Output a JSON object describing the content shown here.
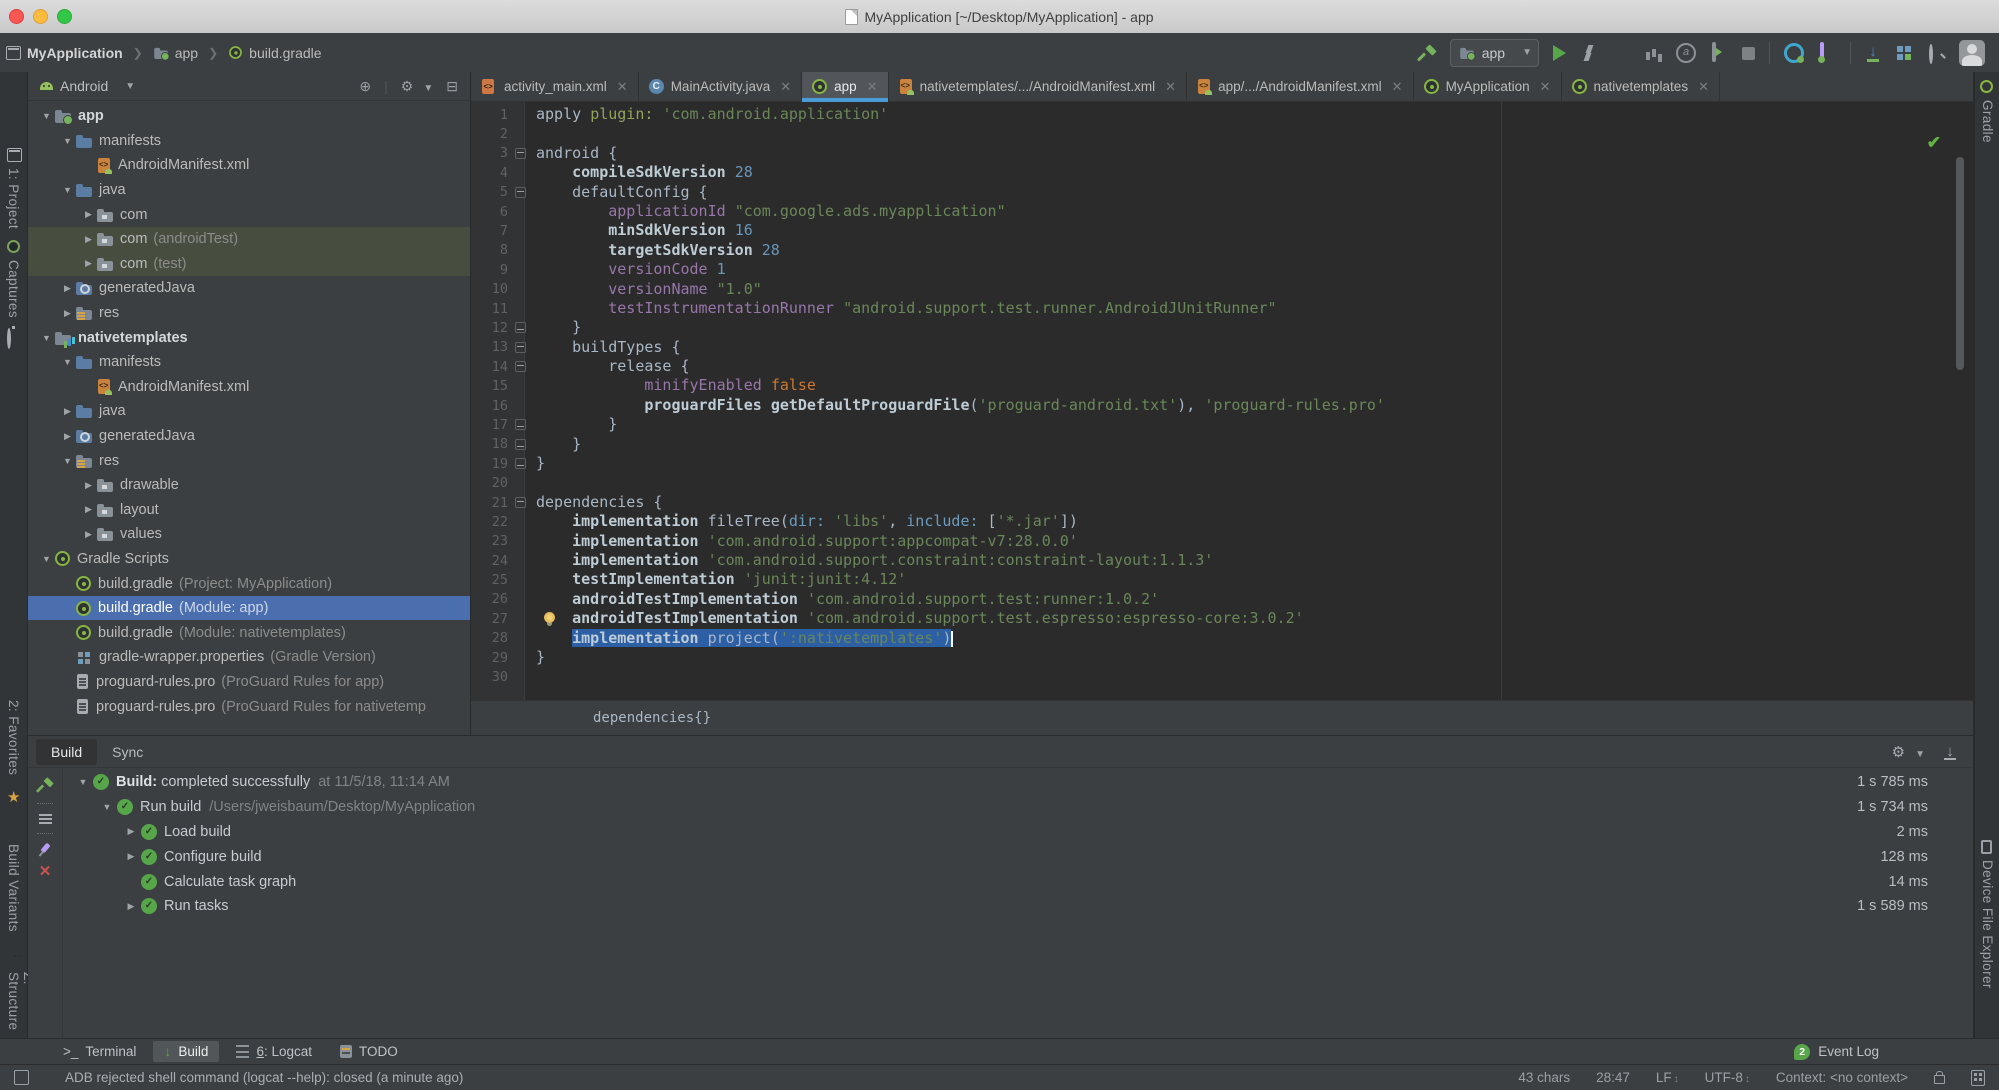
{
  "window": {
    "title": "MyApplication [~/Desktop/MyApplication] - app"
  },
  "toolbar": {
    "breadcrumbs": [
      "MyApplication",
      "app",
      "build.gradle"
    ],
    "run_config": "app"
  },
  "left_stripe": {
    "project": "1: Project",
    "captures": "Captures",
    "favorites": "2: Favorites",
    "build_variants": "Build Variants",
    "structure": "Z: Structure"
  },
  "right_stripe": {
    "gradle": "Gradle",
    "device_file_explorer": "Device File Explorer"
  },
  "project_panel": {
    "view": "Android",
    "tree": [
      {
        "ind": 0,
        "arrow": "down",
        "icon": "folder-app",
        "label": "app",
        "bold": true
      },
      {
        "ind": 1,
        "arrow": "down",
        "icon": "folder",
        "label": "manifests"
      },
      {
        "ind": 2,
        "arrow": "none",
        "icon": "manifest",
        "label": "AndroidManifest.xml"
      },
      {
        "ind": 1,
        "arrow": "down",
        "icon": "folder",
        "label": "java"
      },
      {
        "ind": 2,
        "arrow": "right",
        "icon": "package",
        "label": "com"
      },
      {
        "ind": 2,
        "arrow": "right",
        "icon": "package",
        "label": "com",
        "detail": "(androidTest)",
        "hl": true
      },
      {
        "ind": 2,
        "arrow": "right",
        "icon": "package",
        "label": "com",
        "detail": "(test)",
        "hl": true
      },
      {
        "ind": 1,
        "arrow": "right",
        "icon": "folder-gen",
        "label": "generatedJava"
      },
      {
        "ind": 1,
        "arrow": "right",
        "icon": "folder-res",
        "label": "res"
      },
      {
        "ind": 0,
        "arrow": "down",
        "icon": "module",
        "label": "nativetemplates",
        "bold": true
      },
      {
        "ind": 1,
        "arrow": "down",
        "icon": "folder",
        "label": "manifests"
      },
      {
        "ind": 2,
        "arrow": "none",
        "icon": "manifest",
        "label": "AndroidManifest.xml"
      },
      {
        "ind": 1,
        "arrow": "right",
        "icon": "folder",
        "label": "java"
      },
      {
        "ind": 1,
        "arrow": "right",
        "icon": "folder-gen",
        "label": "generatedJava"
      },
      {
        "ind": 1,
        "arrow": "down",
        "icon": "folder-res",
        "label": "res"
      },
      {
        "ind": 2,
        "arrow": "right",
        "icon": "package",
        "label": "drawable"
      },
      {
        "ind": 2,
        "arrow": "right",
        "icon": "package",
        "label": "layout"
      },
      {
        "ind": 2,
        "arrow": "right",
        "icon": "package",
        "label": "values"
      },
      {
        "ind": 0,
        "arrow": "down",
        "icon": "gradle",
        "label": "Gradle Scripts"
      },
      {
        "ind": 1,
        "arrow": "none",
        "icon": "gradle",
        "label": "build.gradle",
        "detail": "(Project: MyApplication)"
      },
      {
        "ind": 1,
        "arrow": "none",
        "icon": "gradle",
        "label": "build.gradle",
        "detail": "(Module: app)",
        "sel": true
      },
      {
        "ind": 1,
        "arrow": "none",
        "icon": "gradle",
        "label": "build.gradle",
        "detail": "(Module: nativetemplates)"
      },
      {
        "ind": 1,
        "arrow": "none",
        "icon": "wrapper",
        "label": "gradle-wrapper.properties",
        "detail": "(Gradle Version)"
      },
      {
        "ind": 1,
        "arrow": "none",
        "icon": "proguard",
        "label": "proguard-rules.pro",
        "detail": "(ProGuard Rules for app)"
      },
      {
        "ind": 1,
        "arrow": "none",
        "icon": "proguard",
        "label": "proguard-rules.pro",
        "detail": "(ProGuard Rules for nativetemp"
      }
    ]
  },
  "editor": {
    "tabs": [
      {
        "label": "activity_main.xml",
        "icon": "xml"
      },
      {
        "label": "MainActivity.java",
        "icon": "java"
      },
      {
        "label": "app",
        "icon": "gradle",
        "active": true
      },
      {
        "label": "nativetemplates/.../AndroidManifest.xml",
        "icon": "manifest"
      },
      {
        "label": "app/.../AndroidManifest.xml",
        "icon": "manifest"
      },
      {
        "label": "MyApplication",
        "icon": "gradle"
      },
      {
        "label": "nativetemplates",
        "icon": "gradle"
      }
    ],
    "context_bar": "dependencies{}",
    "lines": [
      {
        "n": 1,
        "t": [
          [
            "apply ",
            "p"
          ],
          [
            "plugin:",
            "g"
          ],
          [
            " ",
            "p"
          ],
          [
            "'com.android.application'",
            "s"
          ]
        ]
      },
      {
        "n": 2,
        "t": []
      },
      {
        "n": 3,
        "fold": "s",
        "t": [
          [
            "android {",
            "p"
          ]
        ]
      },
      {
        "n": 4,
        "t": [
          [
            "    ",
            "p"
          ],
          [
            "compileSdkVersion",
            "b"
          ],
          [
            " ",
            "p"
          ],
          [
            "28",
            "n"
          ]
        ]
      },
      {
        "n": 5,
        "fold": "s",
        "t": [
          [
            "    defaultConfig {",
            "p"
          ]
        ]
      },
      {
        "n": 6,
        "t": [
          [
            "        ",
            "p"
          ],
          [
            "applicationId",
            "k"
          ],
          [
            " ",
            "p"
          ],
          [
            "\"com.google.ads.myapplication\"",
            "s"
          ]
        ]
      },
      {
        "n": 7,
        "t": [
          [
            "        ",
            "p"
          ],
          [
            "minSdkVersion",
            "b"
          ],
          [
            " ",
            "p"
          ],
          [
            "16",
            "n"
          ]
        ]
      },
      {
        "n": 8,
        "t": [
          [
            "        ",
            "p"
          ],
          [
            "targetSdkVersion",
            "b"
          ],
          [
            " ",
            "p"
          ],
          [
            "28",
            "n"
          ]
        ]
      },
      {
        "n": 9,
        "t": [
          [
            "        ",
            "p"
          ],
          [
            "versionCode",
            "k"
          ],
          [
            " ",
            "p"
          ],
          [
            "1",
            "n"
          ]
        ]
      },
      {
        "n": 10,
        "t": [
          [
            "        ",
            "p"
          ],
          [
            "versionName",
            "k"
          ],
          [
            " ",
            "p"
          ],
          [
            "\"1.0\"",
            "s"
          ]
        ]
      },
      {
        "n": 11,
        "t": [
          [
            "        ",
            "p"
          ],
          [
            "testInstrumentationRunner",
            "k"
          ],
          [
            " ",
            "p"
          ],
          [
            "\"android.support.test.runner.AndroidJUnitRunner\"",
            "s"
          ]
        ]
      },
      {
        "n": 12,
        "fold": "e",
        "t": [
          [
            "    }",
            "p"
          ]
        ]
      },
      {
        "n": 13,
        "fold": "s",
        "t": [
          [
            "    buildTypes {",
            "p"
          ]
        ]
      },
      {
        "n": 14,
        "fold": "s",
        "t": [
          [
            "        release {",
            "p"
          ]
        ]
      },
      {
        "n": 15,
        "t": [
          [
            "            ",
            "p"
          ],
          [
            "minifyEnabled",
            "k"
          ],
          [
            " ",
            "p"
          ],
          [
            "false",
            "o"
          ]
        ]
      },
      {
        "n": 16,
        "t": [
          [
            "            ",
            "p"
          ],
          [
            "proguardFiles",
            "b"
          ],
          [
            " ",
            "p"
          ],
          [
            "getDefaultProguardFile",
            "b"
          ],
          [
            "(",
            "p"
          ],
          [
            "'proguard-android.txt'",
            "s"
          ],
          [
            "), ",
            "p"
          ],
          [
            "'proguard-rules.pro'",
            "s"
          ]
        ]
      },
      {
        "n": 17,
        "fold": "e",
        "t": [
          [
            "        }",
            "p"
          ]
        ]
      },
      {
        "n": 18,
        "fold": "e",
        "t": [
          [
            "    }",
            "p"
          ]
        ]
      },
      {
        "n": 19,
        "fold": "e",
        "t": [
          [
            "}",
            "p"
          ]
        ]
      },
      {
        "n": 20,
        "t": []
      },
      {
        "n": 21,
        "fold": "s",
        "t": [
          [
            "dependencies {",
            "p"
          ]
        ]
      },
      {
        "n": 22,
        "t": [
          [
            "    ",
            "p"
          ],
          [
            "implementation",
            "b"
          ],
          [
            " fileTree(",
            "p"
          ],
          [
            "dir:",
            "a"
          ],
          [
            " ",
            "p"
          ],
          [
            "'libs'",
            "s"
          ],
          [
            ", ",
            "p"
          ],
          [
            "include:",
            "a"
          ],
          [
            " [",
            "p"
          ],
          [
            "'*.jar'",
            "s"
          ],
          [
            "])",
            "p"
          ]
        ]
      },
      {
        "n": 23,
        "t": [
          [
            "    ",
            "p"
          ],
          [
            "implementation",
            "b"
          ],
          [
            " ",
            "p"
          ],
          [
            "'com.android.support:appcompat-v7:28.0.0'",
            "s"
          ]
        ]
      },
      {
        "n": 24,
        "t": [
          [
            "    ",
            "p"
          ],
          [
            "implementation",
            "b"
          ],
          [
            " ",
            "p"
          ],
          [
            "'com.android.support.constraint:constraint-layout:1.1.3'",
            "s"
          ]
        ]
      },
      {
        "n": 25,
        "t": [
          [
            "    ",
            "p"
          ],
          [
            "testImplementation",
            "b"
          ],
          [
            " ",
            "p"
          ],
          [
            "'junit:junit:4.12'",
            "s"
          ]
        ]
      },
      {
        "n": 26,
        "t": [
          [
            "    ",
            "p"
          ],
          [
            "androidTestImplementation",
            "b"
          ],
          [
            " ",
            "p"
          ],
          [
            "'com.android.support.test:runner:1.0.2'",
            "s"
          ]
        ]
      },
      {
        "n": 27,
        "bulb": true,
        "t": [
          [
            "    ",
            "p"
          ],
          [
            "androidTestImplementation",
            "b"
          ],
          [
            " ",
            "p"
          ],
          [
            "'com.android.support.test.espresso:espresso-core:3.0.2'",
            "s"
          ]
        ]
      },
      {
        "n": 28,
        "sel": true,
        "caret": true,
        "t": [
          [
            "    ",
            "p"
          ],
          [
            "implementation",
            "b"
          ],
          [
            " ",
            "p"
          ],
          [
            "project",
            "p"
          ],
          [
            "(",
            "p"
          ],
          [
            "':nativetemplates'",
            "s"
          ],
          [
            ")",
            "p"
          ]
        ]
      },
      {
        "n": 29,
        "t": [
          [
            "}",
            "p"
          ]
        ]
      },
      {
        "n": 30,
        "t": []
      }
    ]
  },
  "build_panel": {
    "tabs": [
      {
        "label": "Build",
        "active": true
      },
      {
        "label": "Sync"
      }
    ],
    "rows": [
      {
        "ind": 0,
        "arrow": "down",
        "label": "Build:",
        "bold": true,
        "label2": "completed successfully",
        "detail": "at 11/5/18, 11:14 AM",
        "time": "1 s 785 ms"
      },
      {
        "ind": 1,
        "arrow": "down",
        "label": "Run build",
        "label2": "",
        "detail": "/Users/jweisbaum/Desktop/MyApplication",
        "time": "1 s 734 ms"
      },
      {
        "ind": 2,
        "arrow": "right",
        "label": "Load build",
        "label2": "",
        "detail": "",
        "time": "2 ms"
      },
      {
        "ind": 2,
        "arrow": "right",
        "label": "Configure build",
        "label2": "",
        "detail": "",
        "time": "128 ms"
      },
      {
        "ind": 2,
        "arrow": "none",
        "label": "Calculate task graph",
        "label2": "",
        "detail": "",
        "time": "14 ms"
      },
      {
        "ind": 2,
        "arrow": "right",
        "label": "Run tasks",
        "label2": "",
        "detail": "",
        "time": "1 s 589 ms"
      }
    ]
  },
  "bottom_bar": {
    "items": [
      {
        "label": "Terminal",
        "icon": "terminal"
      },
      {
        "label": "Build",
        "icon": "build",
        "active": true
      },
      {
        "label": "6: Logcat",
        "icon": "logcat",
        "mnemonic": true
      },
      {
        "label": "TODO",
        "icon": "todo"
      }
    ],
    "event_log": {
      "label": "Event Log",
      "count": "2"
    }
  },
  "status_bar": {
    "message": "ADB rejected shell command (logcat --help): closed (a minute ago)",
    "chars": "43 chars",
    "caret_pos": "28:47",
    "line_sep": "LF",
    "encoding": "UTF-8",
    "context": "Context: <no context>"
  }
}
